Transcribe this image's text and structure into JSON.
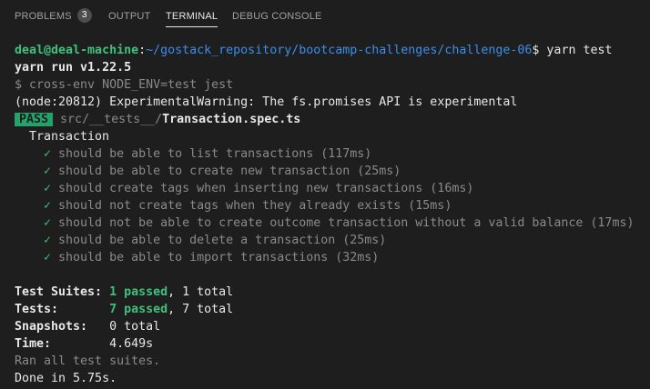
{
  "tabs": [
    {
      "label": "PROBLEMS",
      "badge": "3"
    },
    {
      "label": "OUTPUT"
    },
    {
      "label": "TERMINAL"
    },
    {
      "label": "DEBUG CONSOLE"
    }
  ],
  "terminal": {
    "prompt_user": "deal@deal-machine",
    "prompt_sep": ":",
    "prompt_path": "~/gostack_repository/bootcamp-challenges/challenge-06",
    "prompt_symbol": "$",
    "command": " yarn test",
    "yarn_version": "yarn run v1.22.5",
    "script_cmd": "$ cross-env NODE_ENV=test jest",
    "warning": "(node:20812) ExperimentalWarning: The fs.promises API is experimental",
    "pass_badge": "PASS",
    "spec_dir": "src/__tests__/",
    "spec_file": "Transaction.spec.ts",
    "describe": "Transaction",
    "check_glyph": "✓",
    "tests": [
      "should be able to list transactions (117ms)",
      "should be able to create new transaction (25ms)",
      "should create tags when inserting new transactions (16ms)",
      "should not create tags when they already exists (15ms)",
      "should not be able to create outcome transaction without a valid balance (17ms)",
      "should be able to delete a transaction (25ms)",
      "should be able to import transactions (32ms)"
    ],
    "summary": {
      "suites_label": "Test Suites:",
      "suites_passed": "1 passed",
      "suites_total": ", 1 total",
      "tests_label": "Tests:",
      "tests_passed": "7 passed",
      "tests_total": ", 7 total",
      "snapshots_label": "Snapshots:",
      "snapshots_value": "0 total",
      "time_label": "Time:",
      "time_value": "4.649s"
    },
    "ran_all": "Ran all test suites.",
    "done": "Done in 5.75s."
  },
  "colors": {
    "background": "#1e1e1e",
    "green": "#3fc07c",
    "blue": "#3b8eea",
    "pass_badge_bg": "#23a36a"
  }
}
